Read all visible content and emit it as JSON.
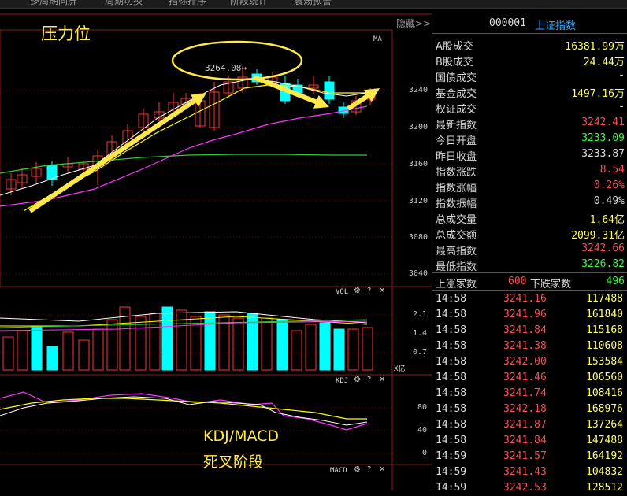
{
  "toolbar": {
    "tabs": [
      "多周期同屏",
      "周期切换",
      "指标排序",
      "阶段统计",
      "震荡预警"
    ],
    "hide_label": "隐藏>>"
  },
  "annotations": {
    "resistance": "压力位",
    "kdj_macd": "KDJ/MACD",
    "death_cross": "死叉阶段",
    "peak_marker": "3264.08→"
  },
  "panels": {
    "main_label": "MA",
    "vol_label": "VOL",
    "kdj_label": "KDJ",
    "macd_label": "MACD",
    "settings_icon": "⚙",
    "help_icon": "?",
    "close_icon": "✕",
    "vol_unit": "X亿"
  },
  "axes": {
    "price": [
      "3240",
      "3200",
      "3160",
      "3120",
      "3080",
      "3040"
    ],
    "vol": [
      "2.1",
      "1.4",
      "0.7"
    ],
    "kdj": [
      "80",
      "40",
      "0"
    ]
  },
  "quote": {
    "code": "000001",
    "name": "上证指数",
    "rows": [
      {
        "label": "A股成交",
        "value": "16381.99万",
        "color": "yellow"
      },
      {
        "label": "B股成交",
        "value": "24.44万",
        "color": "yellow"
      },
      {
        "label": "国债成交",
        "value": "-",
        "color": "yellow"
      },
      {
        "label": "基金成交",
        "value": "1497.16万",
        "color": "yellow"
      },
      {
        "label": "权证成交",
        "value": "-",
        "color": "yellow"
      },
      {
        "label": "最新指数",
        "value": "3242.41",
        "color": "red"
      },
      {
        "label": "今日开盘",
        "value": "3233.09",
        "color": "green"
      },
      {
        "label": "昨日收盘",
        "value": "3233.87",
        "color": "white"
      },
      {
        "label": "指数涨跌",
        "value": "8.54",
        "color": "red"
      },
      {
        "label": "指数涨幅",
        "value": "0.26%",
        "color": "red"
      },
      {
        "label": "指数振幅",
        "value": "0.49%",
        "color": "white"
      },
      {
        "label": "总成交量",
        "value": "1.64亿",
        "color": "yellow"
      },
      {
        "label": "总成交额",
        "value": "2099.31亿",
        "color": "yellow"
      },
      {
        "label": "最高指数",
        "value": "3242.66",
        "color": "red"
      },
      {
        "label": "最低指数",
        "value": "3226.82",
        "color": "green"
      }
    ],
    "breadth": {
      "up_label": "上涨家数",
      "up_value": "600",
      "down_label": "下跌家数",
      "down_value": "496"
    }
  },
  "ticks": [
    {
      "time": "14:58",
      "price": "3241.16",
      "vol": "117488"
    },
    {
      "time": "14:58",
      "price": "3241.96",
      "vol": "161840"
    },
    {
      "time": "14:58",
      "price": "3241.84",
      "vol": "115168"
    },
    {
      "time": "14:58",
      "price": "3241.38",
      "vol": "110608"
    },
    {
      "time": "14:58",
      "price": "3242.00",
      "vol": "153584"
    },
    {
      "time": "14:58",
      "price": "3241.46",
      "vol": "106560"
    },
    {
      "time": "14:58",
      "price": "3241.74",
      "vol": "108416"
    },
    {
      "time": "14:58",
      "price": "3242.18",
      "vol": "168976"
    },
    {
      "time": "14:58",
      "price": "3241.87",
      "vol": "137264"
    },
    {
      "time": "14:58",
      "price": "3241.84",
      "vol": "147488"
    },
    {
      "time": "14:59",
      "price": "3241.57",
      "vol": "164192"
    },
    {
      "time": "14:59",
      "price": "3241.43",
      "vol": "104832"
    },
    {
      "time": "14:59",
      "price": "3242.53",
      "vol": "128512"
    }
  ],
  "colors": {
    "up": "#ff3333",
    "down": "#00ffff",
    "ma5": "#ffffff",
    "ma10": "#ffff00",
    "ma20": "#ff33ff",
    "ma60": "#33cc33",
    "annotation": "#ffe94a"
  }
}
